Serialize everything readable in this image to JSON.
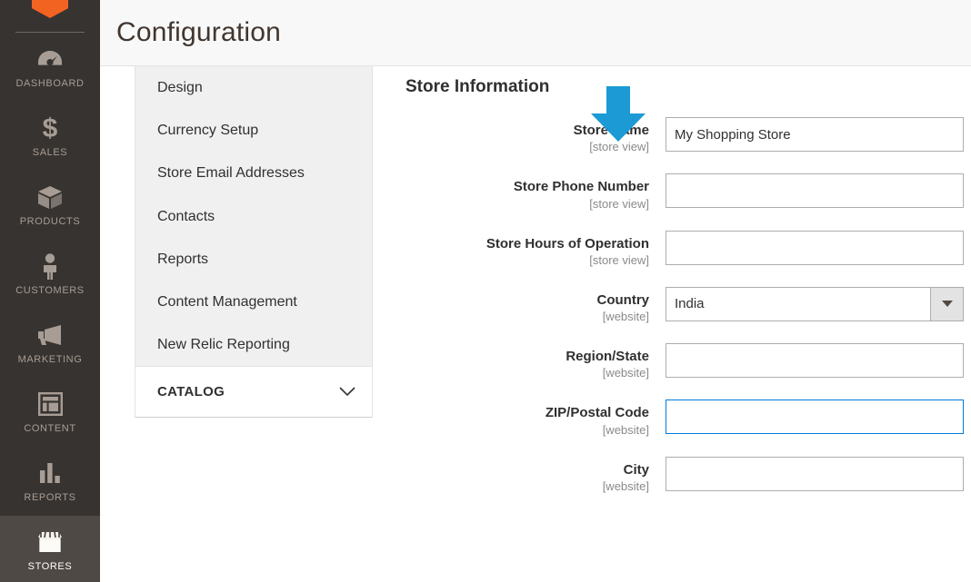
{
  "theme": {
    "sidebar_bg": "#373330",
    "sidebar_active_bg": "#4f4945",
    "logo_color": "#f26322",
    "accent_focus": "#007bdb",
    "arrow_color": "#1b9ad6",
    "nav_panel_bg": "#f0f0f0",
    "header_bg": "#f8f8f8"
  },
  "sidebar": {
    "logo_name": "magento-logo",
    "items": [
      {
        "label": "DASHBOARD",
        "icon": "dashboard-gauge-icon",
        "active": false
      },
      {
        "label": "SALES",
        "icon": "dollar-sign-icon",
        "active": false
      },
      {
        "label": "PRODUCTS",
        "icon": "box-package-icon",
        "active": false
      },
      {
        "label": "CUSTOMERS",
        "icon": "person-icon",
        "active": false
      },
      {
        "label": "MARKETING",
        "icon": "megaphone-icon",
        "active": false
      },
      {
        "label": "CONTENT",
        "icon": "layout-window-icon",
        "active": false
      },
      {
        "label": "REPORTS",
        "icon": "bar-chart-icon",
        "active": false
      },
      {
        "label": "STORES",
        "icon": "storefront-icon",
        "active": true
      }
    ]
  },
  "header": {
    "title": "Configuration"
  },
  "config_nav": {
    "items": [
      {
        "label": "Design"
      },
      {
        "label": "Currency Setup"
      },
      {
        "label": "Store Email Addresses"
      },
      {
        "label": "Contacts"
      },
      {
        "label": "Reports"
      },
      {
        "label": "Content Management"
      },
      {
        "label": "New Relic Reporting"
      }
    ],
    "section": {
      "label": "CATALOG",
      "chevron_icon": "chevron-down-icon",
      "expanded": false
    }
  },
  "main": {
    "section_title": "Store Information",
    "annotation": {
      "icon": "down-arrow-annotation",
      "color": "#1b9ad6"
    },
    "fields": [
      {
        "label": "Store Name",
        "scope": "[store view]",
        "type": "text",
        "value": "My Shopping Store",
        "placeholder": "",
        "focused": false
      },
      {
        "label": "Store Phone Number",
        "scope": "[store view]",
        "type": "text",
        "value": "",
        "placeholder": "",
        "focused": false
      },
      {
        "label": "Store Hours of Operation",
        "scope": "[store view]",
        "type": "text",
        "value": "",
        "placeholder": "",
        "focused": false
      },
      {
        "label": "Country",
        "scope": "[website]",
        "type": "select",
        "value": "India",
        "placeholder": "",
        "focused": false
      },
      {
        "label": "Region/State",
        "scope": "[website]",
        "type": "text",
        "value": "",
        "placeholder": "",
        "focused": false
      },
      {
        "label": "ZIP/Postal Code",
        "scope": "[website]",
        "type": "text",
        "value": "",
        "placeholder": "",
        "focused": true
      },
      {
        "label": "City",
        "scope": "[website]",
        "type": "text",
        "value": "",
        "placeholder": "",
        "focused": false
      }
    ]
  }
}
